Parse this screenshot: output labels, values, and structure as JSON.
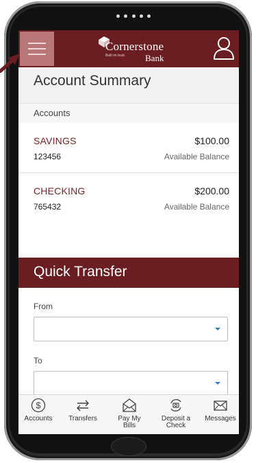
{
  "header": {
    "brand": "Cornerstone",
    "brand_sub": "Bank",
    "tagline": "Built on trust."
  },
  "summary": {
    "title": "Account Summary",
    "section_label": "Accounts",
    "accounts": [
      {
        "name": "SAVINGS",
        "number": "123456",
        "balance": "$100.00",
        "balance_label": "Available Balance"
      },
      {
        "name": "CHECKING",
        "number": "765432",
        "balance": "$200.00",
        "balance_label": "Available Balance"
      }
    ]
  },
  "quick_transfer": {
    "title": "Quick Transfer",
    "from_label": "From",
    "from_value": "",
    "to_label": "To",
    "to_value": ""
  },
  "tabs": [
    {
      "label": "Accounts",
      "icon": "dollar-circle-icon"
    },
    {
      "label": "Transfers",
      "icon": "swap-arrows-icon"
    },
    {
      "label": "Pay My Bills",
      "icon": "envelope-open-icon"
    },
    {
      "label": "Deposit a Check",
      "icon": "camera-cycle-icon"
    },
    {
      "label": "Messages",
      "icon": "envelope-icon"
    }
  ],
  "colors": {
    "brand": "#6b1e22",
    "accent_red": "#7a2429",
    "caret_blue": "#3a7bbf",
    "menu_highlight": "#b9777a"
  }
}
